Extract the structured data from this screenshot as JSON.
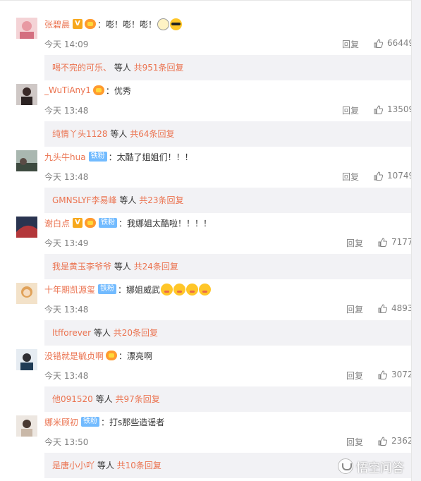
{
  "reply_label": "回复",
  "colon": "：",
  "comments": [
    {
      "name": "张碧晨",
      "badges": [
        "v",
        "fan"
      ],
      "text": "嘭！嘭！嘭！",
      "emojis": [
        "round-glasses",
        "glasses"
      ],
      "time": "今天 14:09",
      "likes": "66449",
      "replies": {
        "name": "喝不完的可乐、",
        "mid": " 等人 ",
        "total": "共951条回复"
      }
    },
    {
      "name": "_WuTiAny1",
      "badges": [
        "fan"
      ],
      "text": "优秀",
      "emojis": [],
      "time": "今天 13:48",
      "likes": "13509",
      "replies": {
        "name": "纯情丫头1128",
        "mid": " 等人 ",
        "total": "共64条回复"
      }
    },
    {
      "name": "九头牛hua",
      "badges": [
        "tie"
      ],
      "text": "太酷了姐姐们！！！",
      "emojis": [],
      "time": "今天 13:48",
      "likes": "10749",
      "replies": {
        "name": "GMNSLYF李易峰",
        "mid": " 等人 ",
        "total": "共23条回复"
      }
    },
    {
      "name": "谢白点",
      "badges": [
        "v",
        "fan",
        "tie"
      ],
      "text": "我娜姐太酷啦！！！！",
      "emojis": [],
      "time": "今天 13:49",
      "likes": "7177",
      "replies": {
        "name": "我是黄玉李爷爷",
        "mid": " 等人 ",
        "total": "共24条回复"
      }
    },
    {
      "name": "十年期凯源玺",
      "badges": [
        "tie"
      ],
      "text": "娜姐威武",
      "emojis": [
        "blush",
        "blush",
        "blush",
        "blush"
      ],
      "time": "今天 13:48",
      "likes": "4893",
      "replies": {
        "name": "ltfforever",
        "mid": " 等人 ",
        "total": "共20条回复"
      }
    },
    {
      "name": "没错就是毓贞啊",
      "badges": [
        "fan"
      ],
      "text": "漂亮啊",
      "emojis": [],
      "time": "今天 13:48",
      "likes": "3072",
      "replies": {
        "name": "他091520",
        "mid": " 等人 ",
        "total": "共97条回复"
      }
    },
    {
      "name": "娜米顾初",
      "badges": [
        "tie"
      ],
      "text": "打s那些造谣者",
      "emojis": [],
      "time": "今天 13:50",
      "likes": "2362",
      "replies": {
        "name": "是唐小小吖",
        "mid": " 等人 ",
        "total": "共10条回复"
      }
    }
  ],
  "badge_labels": {
    "v": "V",
    "tie": "铁粉"
  },
  "watermark": "悟空问答",
  "colors": {
    "name": "#eb7350",
    "meta": "#808080",
    "reply_bg": "#f2f2f5",
    "tie_badge": "#72bbff",
    "v_badge": "#f7a81c"
  }
}
